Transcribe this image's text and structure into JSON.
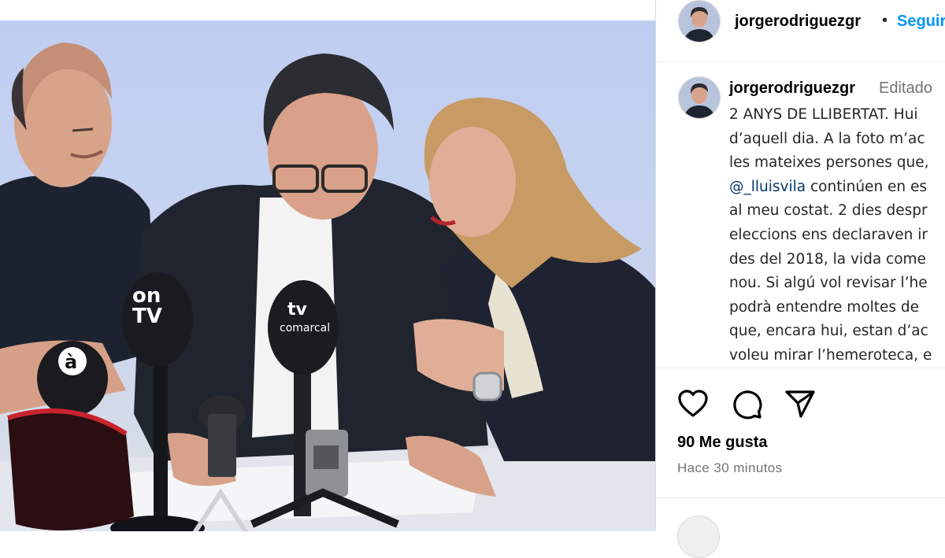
{
  "post": {
    "username": "jorgerodriguezgr",
    "follow_label": "Seguir",
    "dot": "•",
    "edited_label": "Editado",
    "caption_lines": [
      "2 ANYS DE LLIBERTAT. Hui",
      "d’aquell dia. A la foto m’ac",
      "les mateixes persones que,",
      "@_lluisvila",
      "continúen en es",
      "al meu costat. 2 dies despr",
      "eleccions ens declaraven ir",
      "des del 2018, la vida come",
      "nou. Si algú vol revisar l’he",
      "podrà entendre moltes de",
      "que, encara hui, estan d’ac",
      "voleu mirar l’hemeroteca, e"
    ],
    "likes": "90 Me gusta",
    "time": "Hace 30 minutos"
  },
  "photo": {
    "microphone_labels": [
      "on",
      "TV",
      "à",
      "tv",
      "comarcal"
    ],
    "colors": {
      "background": "#c3d0f0",
      "table": "#e3e7ec",
      "suit_dark": "#1f232f",
      "shirt_white": "#f4f4f4",
      "skin": "#d9a58c",
      "hair_dark": "#2b2b2e",
      "hair_blonde": "#c79a62"
    }
  },
  "icons": {
    "like": "heart-icon",
    "comment": "comment-icon",
    "share": "share-icon"
  }
}
